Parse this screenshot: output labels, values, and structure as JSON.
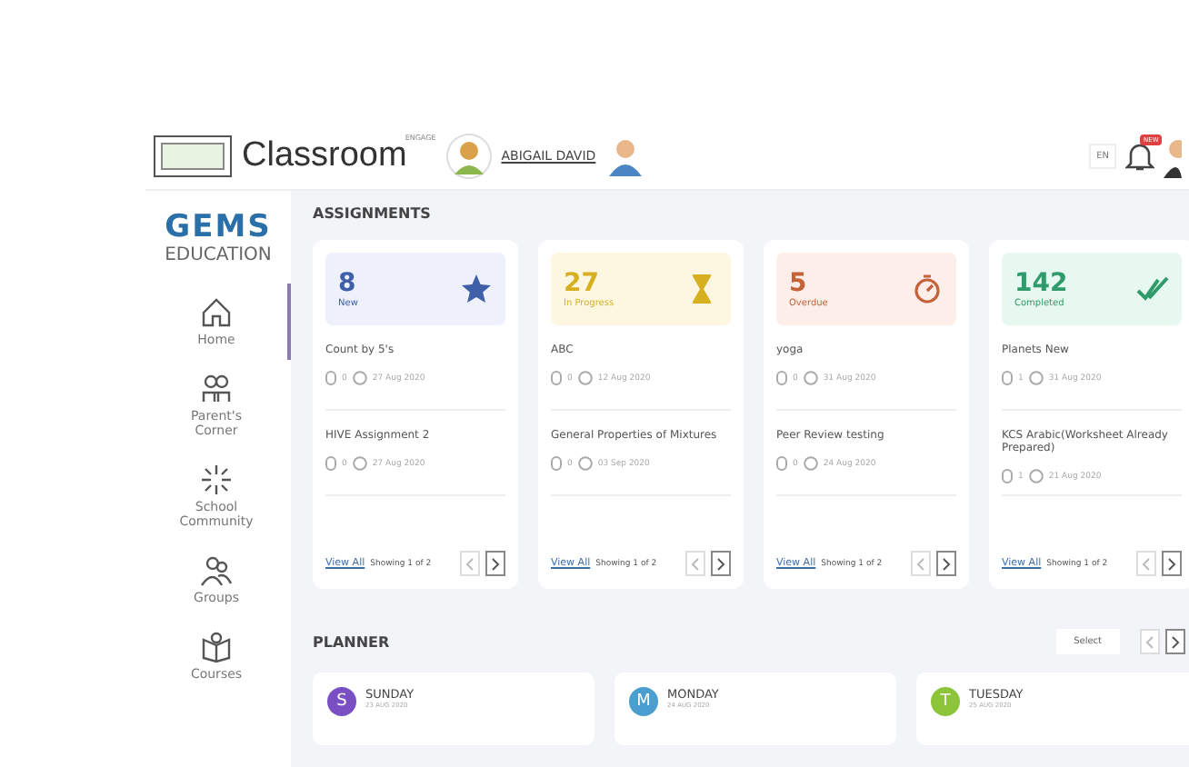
{
  "header": {
    "brand": "Classroom",
    "brand_tag": "ENGAGE",
    "user": "ABIGAIL DAVID",
    "language": "EN",
    "notification_badge": "NEW"
  },
  "sidebar": {
    "logo": "GEMS",
    "logo_sub": "EDUCATION",
    "items": [
      {
        "label": "Home",
        "kind": "home",
        "selected": true
      },
      {
        "label": "Parent's Corner",
        "kind": "parents",
        "selected": false
      },
      {
        "label": "School Community",
        "kind": "community",
        "selected": false
      },
      {
        "label": "Groups",
        "kind": "groups",
        "selected": false
      },
      {
        "label": "Courses",
        "kind": "courses",
        "selected": false
      }
    ]
  },
  "assignments": {
    "title": "ASSIGNMENTS",
    "cards": [
      {
        "count": "8",
        "status": "New",
        "kind": "new",
        "color": "#3f5fa8",
        "items": [
          {
            "title": "Count by 5's",
            "files": "0",
            "date": "27 Aug 2020"
          },
          {
            "title": "HIVE Assignment 2",
            "files": "0",
            "date": "27 Aug 2020"
          }
        ],
        "view_all": "View All",
        "showing": "Showing 1 of 2"
      },
      {
        "count": "27",
        "status": "In Progress",
        "kind": "progress",
        "color": "#d6b021",
        "items": [
          {
            "title": "ABC",
            "files": "0",
            "date": "12 Aug 2020"
          },
          {
            "title": "General Properties of Mixtures",
            "files": "0",
            "date": "03 Sep 2020"
          }
        ],
        "view_all": "View All",
        "showing": "Showing 1 of 2"
      },
      {
        "count": "5",
        "status": "Overdue",
        "kind": "overdue",
        "color": "#c4623a",
        "items": [
          {
            "title": "yoga",
            "files": "0",
            "date": "31 Aug 2020"
          },
          {
            "title": "Peer Review testing",
            "files": "0",
            "date": "24 Aug 2020"
          }
        ],
        "view_all": "View All",
        "showing": "Showing 1 of 2"
      },
      {
        "count": "142",
        "status": "Completed",
        "kind": "completed",
        "color": "#2f9a6a",
        "items": [
          {
            "title": "Planets New",
            "files": "1",
            "date": "31 Aug 2020"
          },
          {
            "title": "KCS Arabic(Worksheet Already Prepared)",
            "files": "1",
            "date": "21 Aug 2020"
          }
        ],
        "view_all": "View All",
        "showing": "Showing 1 of 2"
      }
    ]
  },
  "planner": {
    "title": "PLANNER",
    "select": "Select",
    "days": [
      {
        "initial": "S",
        "day": "SUNDAY",
        "date": "23 AUG 2020",
        "color": "#7b4fc4"
      },
      {
        "initial": "M",
        "day": "MONDAY",
        "date": "24 AUG 2020",
        "color": "#4a9fd0"
      },
      {
        "initial": "T",
        "day": "TUESDAY",
        "date": "25 AUG 2020",
        "color": "#8cc43a"
      }
    ]
  }
}
